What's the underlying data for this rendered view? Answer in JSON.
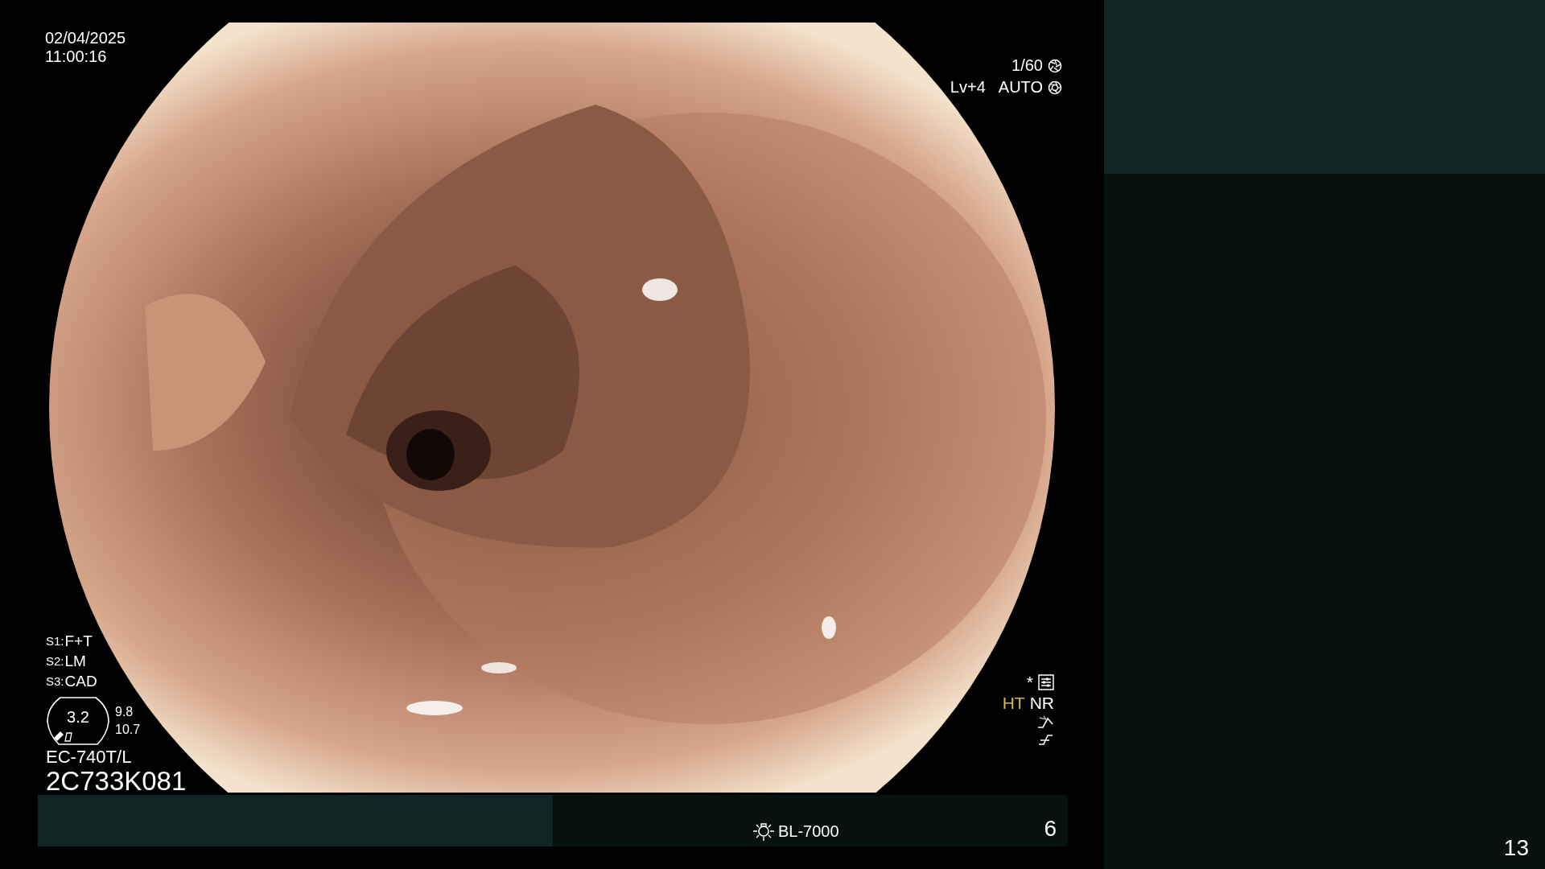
{
  "datetime": {
    "date": "02/04/2025",
    "time": "11:00:16"
  },
  "exposure": {
    "shutter": "1/60",
    "level": "Lv+4",
    "mode": "AUTO"
  },
  "switches": [
    {
      "key": "S1:",
      "value": "F+T"
    },
    {
      "key": "S2:",
      "value": "LM"
    },
    {
      "key": "S3:",
      "value": "CAD"
    }
  ],
  "zoom_gauge": {
    "value": "3.2",
    "upper": "9.8",
    "lower": "10.7"
  },
  "scope": {
    "model": "EC-740T/L",
    "serial": "2C733K081"
  },
  "processing": {
    "asterisk": "*",
    "modes": [
      {
        "label": "HT",
        "color": "#d8b848"
      },
      {
        "label": "NR",
        "color": "#ffffff"
      }
    ]
  },
  "footer": {
    "light_source": "BL-7000",
    "count": "6"
  },
  "page_number": "13"
}
